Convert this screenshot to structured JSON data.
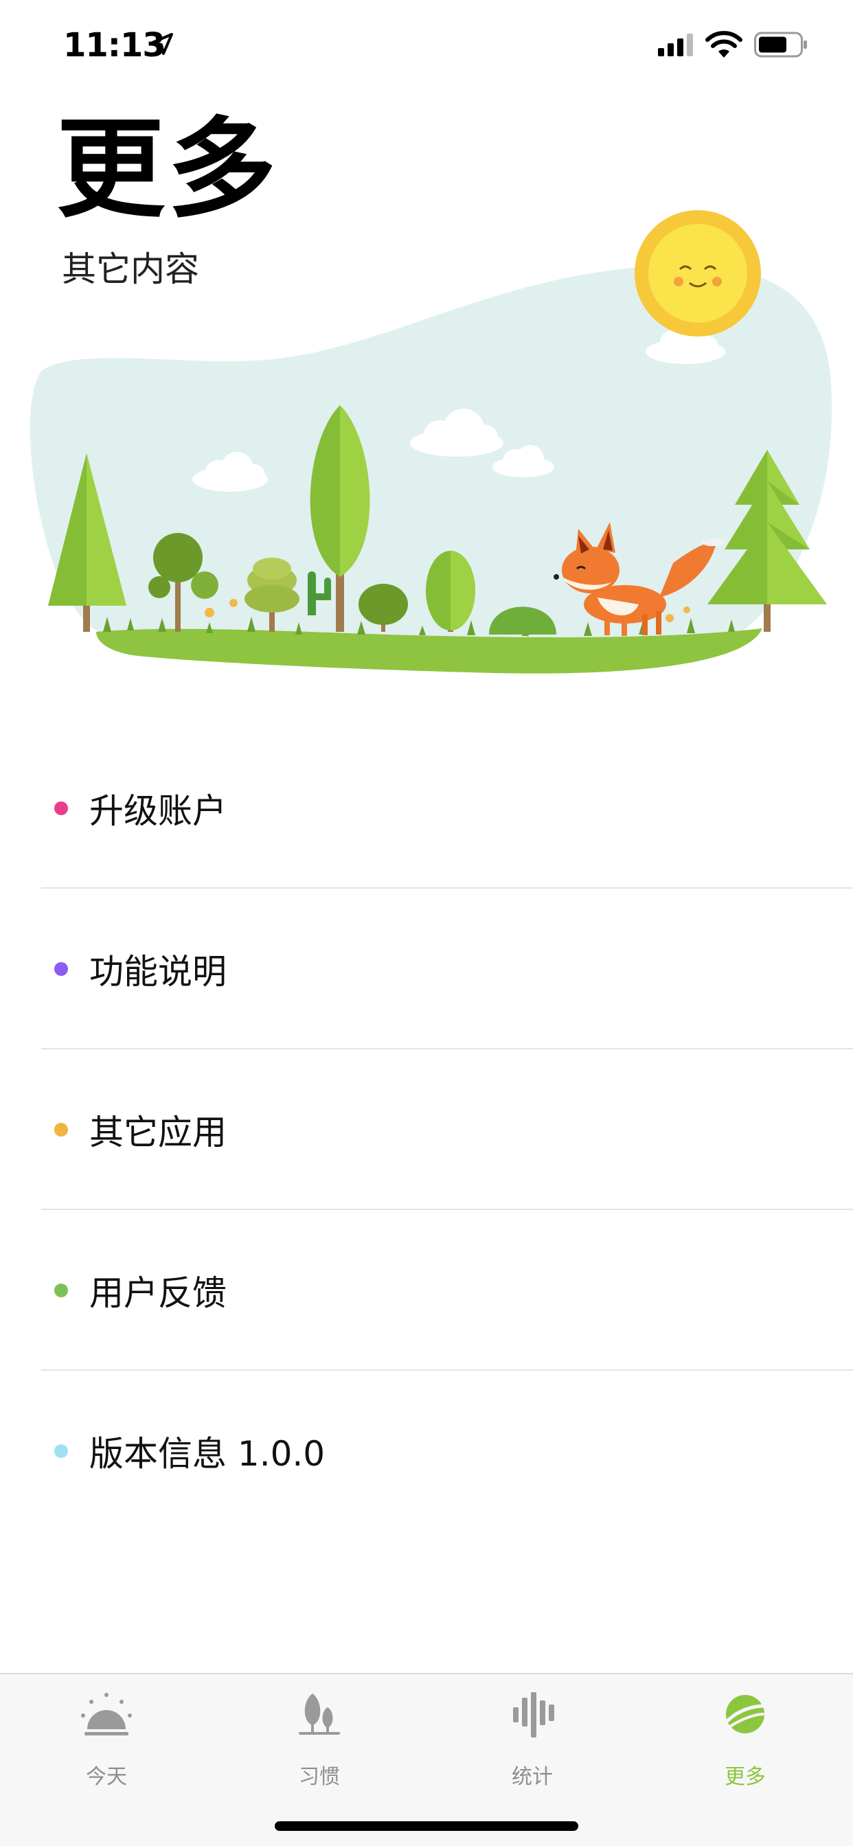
{
  "status_bar": {
    "time": "11:13"
  },
  "header": {
    "title": "更多",
    "subtitle": "其它内容"
  },
  "menu": {
    "items": [
      {
        "label": "升级账户",
        "color": "#e83e8c"
      },
      {
        "label": "功能说明",
        "color": "#8b5cf6"
      },
      {
        "label": "其它应用",
        "color": "#f0b440"
      },
      {
        "label": "用户反馈",
        "color": "#7cc05a"
      },
      {
        "label": "版本信息 1.0.0",
        "color": "#9fe0f5"
      }
    ]
  },
  "tab_bar": {
    "tabs": [
      {
        "label": "今天",
        "icon": "sunrise-icon"
      },
      {
        "label": "习惯",
        "icon": "trees-icon"
      },
      {
        "label": "统计",
        "icon": "bars-icon"
      },
      {
        "label": "更多",
        "icon": "planet-icon",
        "active": true
      }
    ],
    "active_color": "#8cc63f",
    "inactive_color": "#8e8e8e"
  }
}
